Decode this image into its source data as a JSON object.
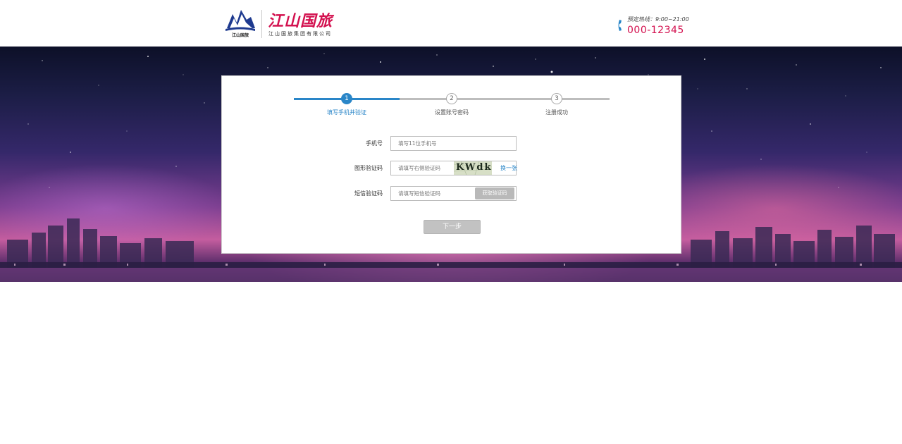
{
  "header": {
    "logo_title": "江山国旅",
    "logo_subtitle": "江山国旅集团有限公司",
    "logo_mark_text": "江山国旅",
    "hotline_label": "预定热线：9:00~21:00",
    "hotline_number": "000-12345"
  },
  "steps": [
    {
      "number": "1",
      "label": "填写手机并验证",
      "active": true
    },
    {
      "number": "2",
      "label": "设置账号密码",
      "active": false
    },
    {
      "number": "3",
      "label": "注册成功",
      "active": false
    }
  ],
  "form": {
    "phone": {
      "label": "手机号",
      "placeholder": "填写11位手机号"
    },
    "captcha": {
      "label": "图形验证码",
      "placeholder": "请填写右侧验证码",
      "image_text": "KWdk",
      "refresh_label": "换一张"
    },
    "sms": {
      "label": "短信验证码",
      "placeholder": "请填写短信验证码",
      "button_label": "获取验证码"
    },
    "next_label": "下一步"
  },
  "colors": {
    "brand": "#d3114f",
    "accent": "#2a86c8",
    "inactive_step": "#bdbdbd",
    "disabled_button": "#c2c2c2"
  },
  "icons": {
    "phone": "phone-icon",
    "logo": "mountain-logo-icon"
  }
}
